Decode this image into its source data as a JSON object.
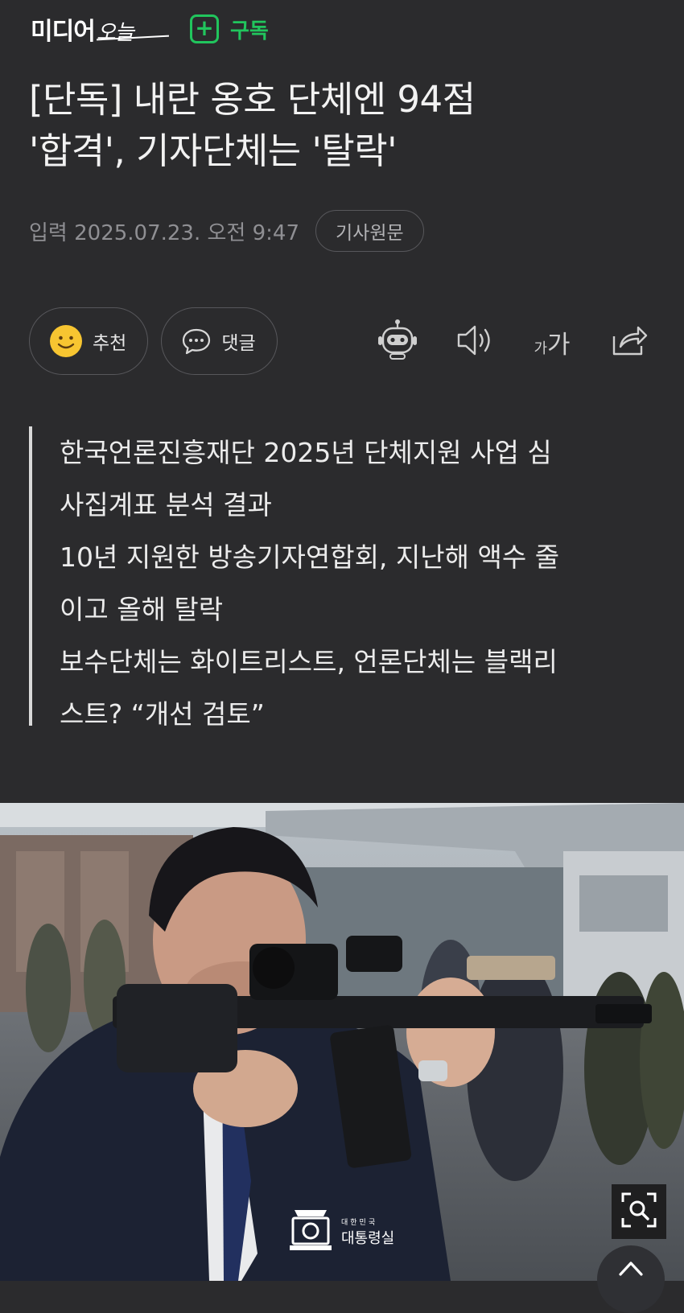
{
  "header": {
    "logo_main": "미디어",
    "logo_script": "오늘",
    "subscribe_label": "구독"
  },
  "article": {
    "title_line1": "[단독] 내란 옹호 단체엔 94점",
    "title_line2": "'합격', 기자단체는 '탈락'",
    "date": "입력 2025.07.23. 오전 9:47",
    "original_label": "기사원문",
    "recommend_label": "추천",
    "comment_label": "댓글",
    "font_small": "가",
    "font_large": "가",
    "summary_lines": [
      "한국언론진흥재단 2025년 단체지원 사업 심",
      "사집계표 분석 결과",
      "10년 지원한 방송기자연합회, 지난해 액수 줄",
      "이고 올해 탈락",
      "보수단체는 화이트리스트, 언론단체는 블랙리",
      "스트? “개선 검토”"
    ]
  },
  "photo": {
    "watermark_small": "대한민국",
    "watermark_main": "대통령실"
  },
  "colors": {
    "background": "#2b2b2d",
    "accent_green": "#21c55d",
    "meta_gray": "#8f8f93"
  },
  "icons": {
    "subscribe": "plus-icon",
    "recommend": "smiley-icon",
    "comment": "speech-bubble-icon",
    "summary_bot": "robot-icon",
    "listen": "speaker-icon",
    "share": "share-icon",
    "zoom": "zoom-icon",
    "top": "arrow-up-icon"
  }
}
